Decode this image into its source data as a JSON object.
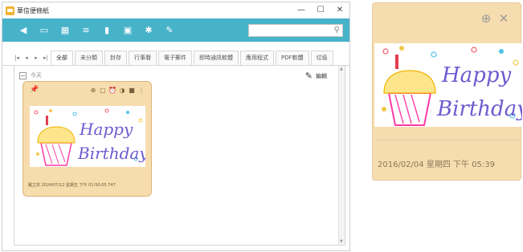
{
  "window": {
    "title": "華信便條紙",
    "controls": [
      "—",
      "☐",
      "✕"
    ]
  },
  "toolbar": {
    "icons": [
      "back-arrow-icon",
      "card-icon",
      "calendar-icon",
      "list-icon",
      "trash-icon",
      "archive-icon",
      "gear-icon",
      "pen-icon"
    ],
    "search_placeholder": ""
  },
  "tabs": {
    "nav": [
      "|◂",
      "◂",
      "▸",
      "▸|"
    ],
    "items": [
      "全部",
      "未分類",
      "封存",
      "行事曆",
      "電子郵件",
      "即時通訊軟體",
      "應用程式",
      "PDF軟體",
      "垃圾"
    ],
    "active_index": 0
  },
  "content": {
    "group_label": "今天",
    "edit_label": "編輯"
  },
  "note": {
    "meta": "羅立宗 2024/07/12 星期五 下午 01:50:05.747",
    "image_text_line1": "Happy",
    "image_text_line2": "Birthday!"
  },
  "popup": {
    "meta": "2016/02/04 星期四 下午 05:39",
    "image_text_line1": "Happy",
    "image_text_line2": "Birthday!"
  }
}
